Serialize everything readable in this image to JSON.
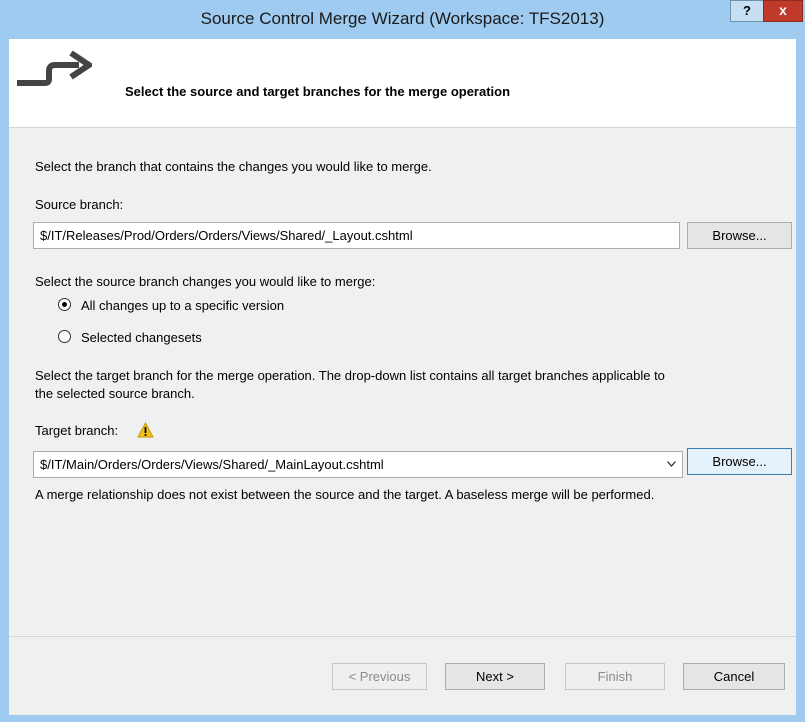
{
  "window": {
    "title": "Source Control Merge Wizard (Workspace: TFS2013)",
    "help_label": "?",
    "close_label": "x"
  },
  "header": {
    "text": "Select the source and target branches for the merge operation",
    "icon": "merge-arrow-icon"
  },
  "source": {
    "intro": "Select the branch that contains the changes you would like to merge.",
    "label": "Source branch:",
    "value": "$/IT/Releases/Prod/Orders/Orders/Views/Shared/_Layout.cshtml",
    "browse_label": "Browse..."
  },
  "changes": {
    "label": "Select the source branch changes you would like to merge:",
    "options": [
      {
        "label": "All changes up to a specific version",
        "checked": true
      },
      {
        "label": "Selected changesets",
        "checked": false
      }
    ]
  },
  "target": {
    "intro_line1": "Select the target branch for the merge operation.  The drop-down list contains all target branches applicable to",
    "intro_line2": "the selected source branch.",
    "label": "Target branch:",
    "value": "$/IT/Main/Orders/Orders/Views/Shared/_MainLayout.cshtml",
    "browse_label": "Browse...",
    "warning": "A merge relationship does not exist between the source and the target. A baseless merge will be performed."
  },
  "footer": {
    "previous": "< Previous",
    "next": "Next >",
    "finish": "Finish",
    "cancel": "Cancel"
  },
  "colors": {
    "titlebar": "#9ecbef",
    "close": "#c0392b",
    "warning": "#f2c21b"
  }
}
